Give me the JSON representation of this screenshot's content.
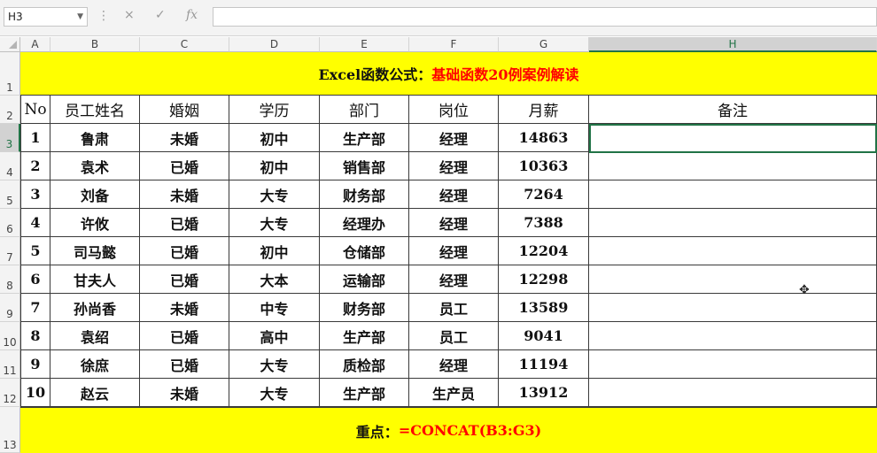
{
  "formula_bar": {
    "name_box": "H3",
    "cancel_icon": "×",
    "confirm_icon": "✓",
    "fx_icon": "fx",
    "formula": ""
  },
  "columns": [
    "A",
    "B",
    "C",
    "D",
    "E",
    "F",
    "G",
    "H"
  ],
  "rows": [
    "1",
    "2",
    "3",
    "4",
    "5",
    "6",
    "7",
    "8",
    "9",
    "10",
    "11",
    "12",
    "13"
  ],
  "title": {
    "part1": "Excel函数公式：",
    "part2": "基础函数20例案例解读"
  },
  "headers": [
    "No",
    "员工姓名",
    "婚姻",
    "学历",
    "部门",
    "岗位",
    "月薪",
    "备注"
  ],
  "data": [
    [
      "1",
      "鲁肃",
      "未婚",
      "初中",
      "生产部",
      "经理",
      "14863",
      ""
    ],
    [
      "2",
      "袁术",
      "已婚",
      "初中",
      "销售部",
      "经理",
      "10363",
      ""
    ],
    [
      "3",
      "刘备",
      "未婚",
      "大专",
      "财务部",
      "经理",
      "7264",
      ""
    ],
    [
      "4",
      "许攸",
      "已婚",
      "大专",
      "经理办",
      "经理",
      "7388",
      ""
    ],
    [
      "5",
      "司马懿",
      "已婚",
      "初中",
      "仓储部",
      "经理",
      "12204",
      ""
    ],
    [
      "6",
      "甘夫人",
      "已婚",
      "大本",
      "运输部",
      "经理",
      "12298",
      ""
    ],
    [
      "7",
      "孙尚香",
      "未婚",
      "中专",
      "财务部",
      "员工",
      "13589",
      ""
    ],
    [
      "8",
      "袁绍",
      "已婚",
      "高中",
      "生产部",
      "员工",
      "9041",
      ""
    ],
    [
      "9",
      "徐庶",
      "已婚",
      "大专",
      "质检部",
      "经理",
      "11194",
      ""
    ],
    [
      "10",
      "赵云",
      "未婚",
      "大专",
      "生产部",
      "生产员",
      "13912",
      ""
    ]
  ],
  "footer": {
    "part1": "重点：",
    "part2": "=CONCAT(B3:G3)"
  },
  "colors": {
    "highlight": "#ffff00",
    "accent": "#ff0000",
    "selection": "#217346"
  }
}
